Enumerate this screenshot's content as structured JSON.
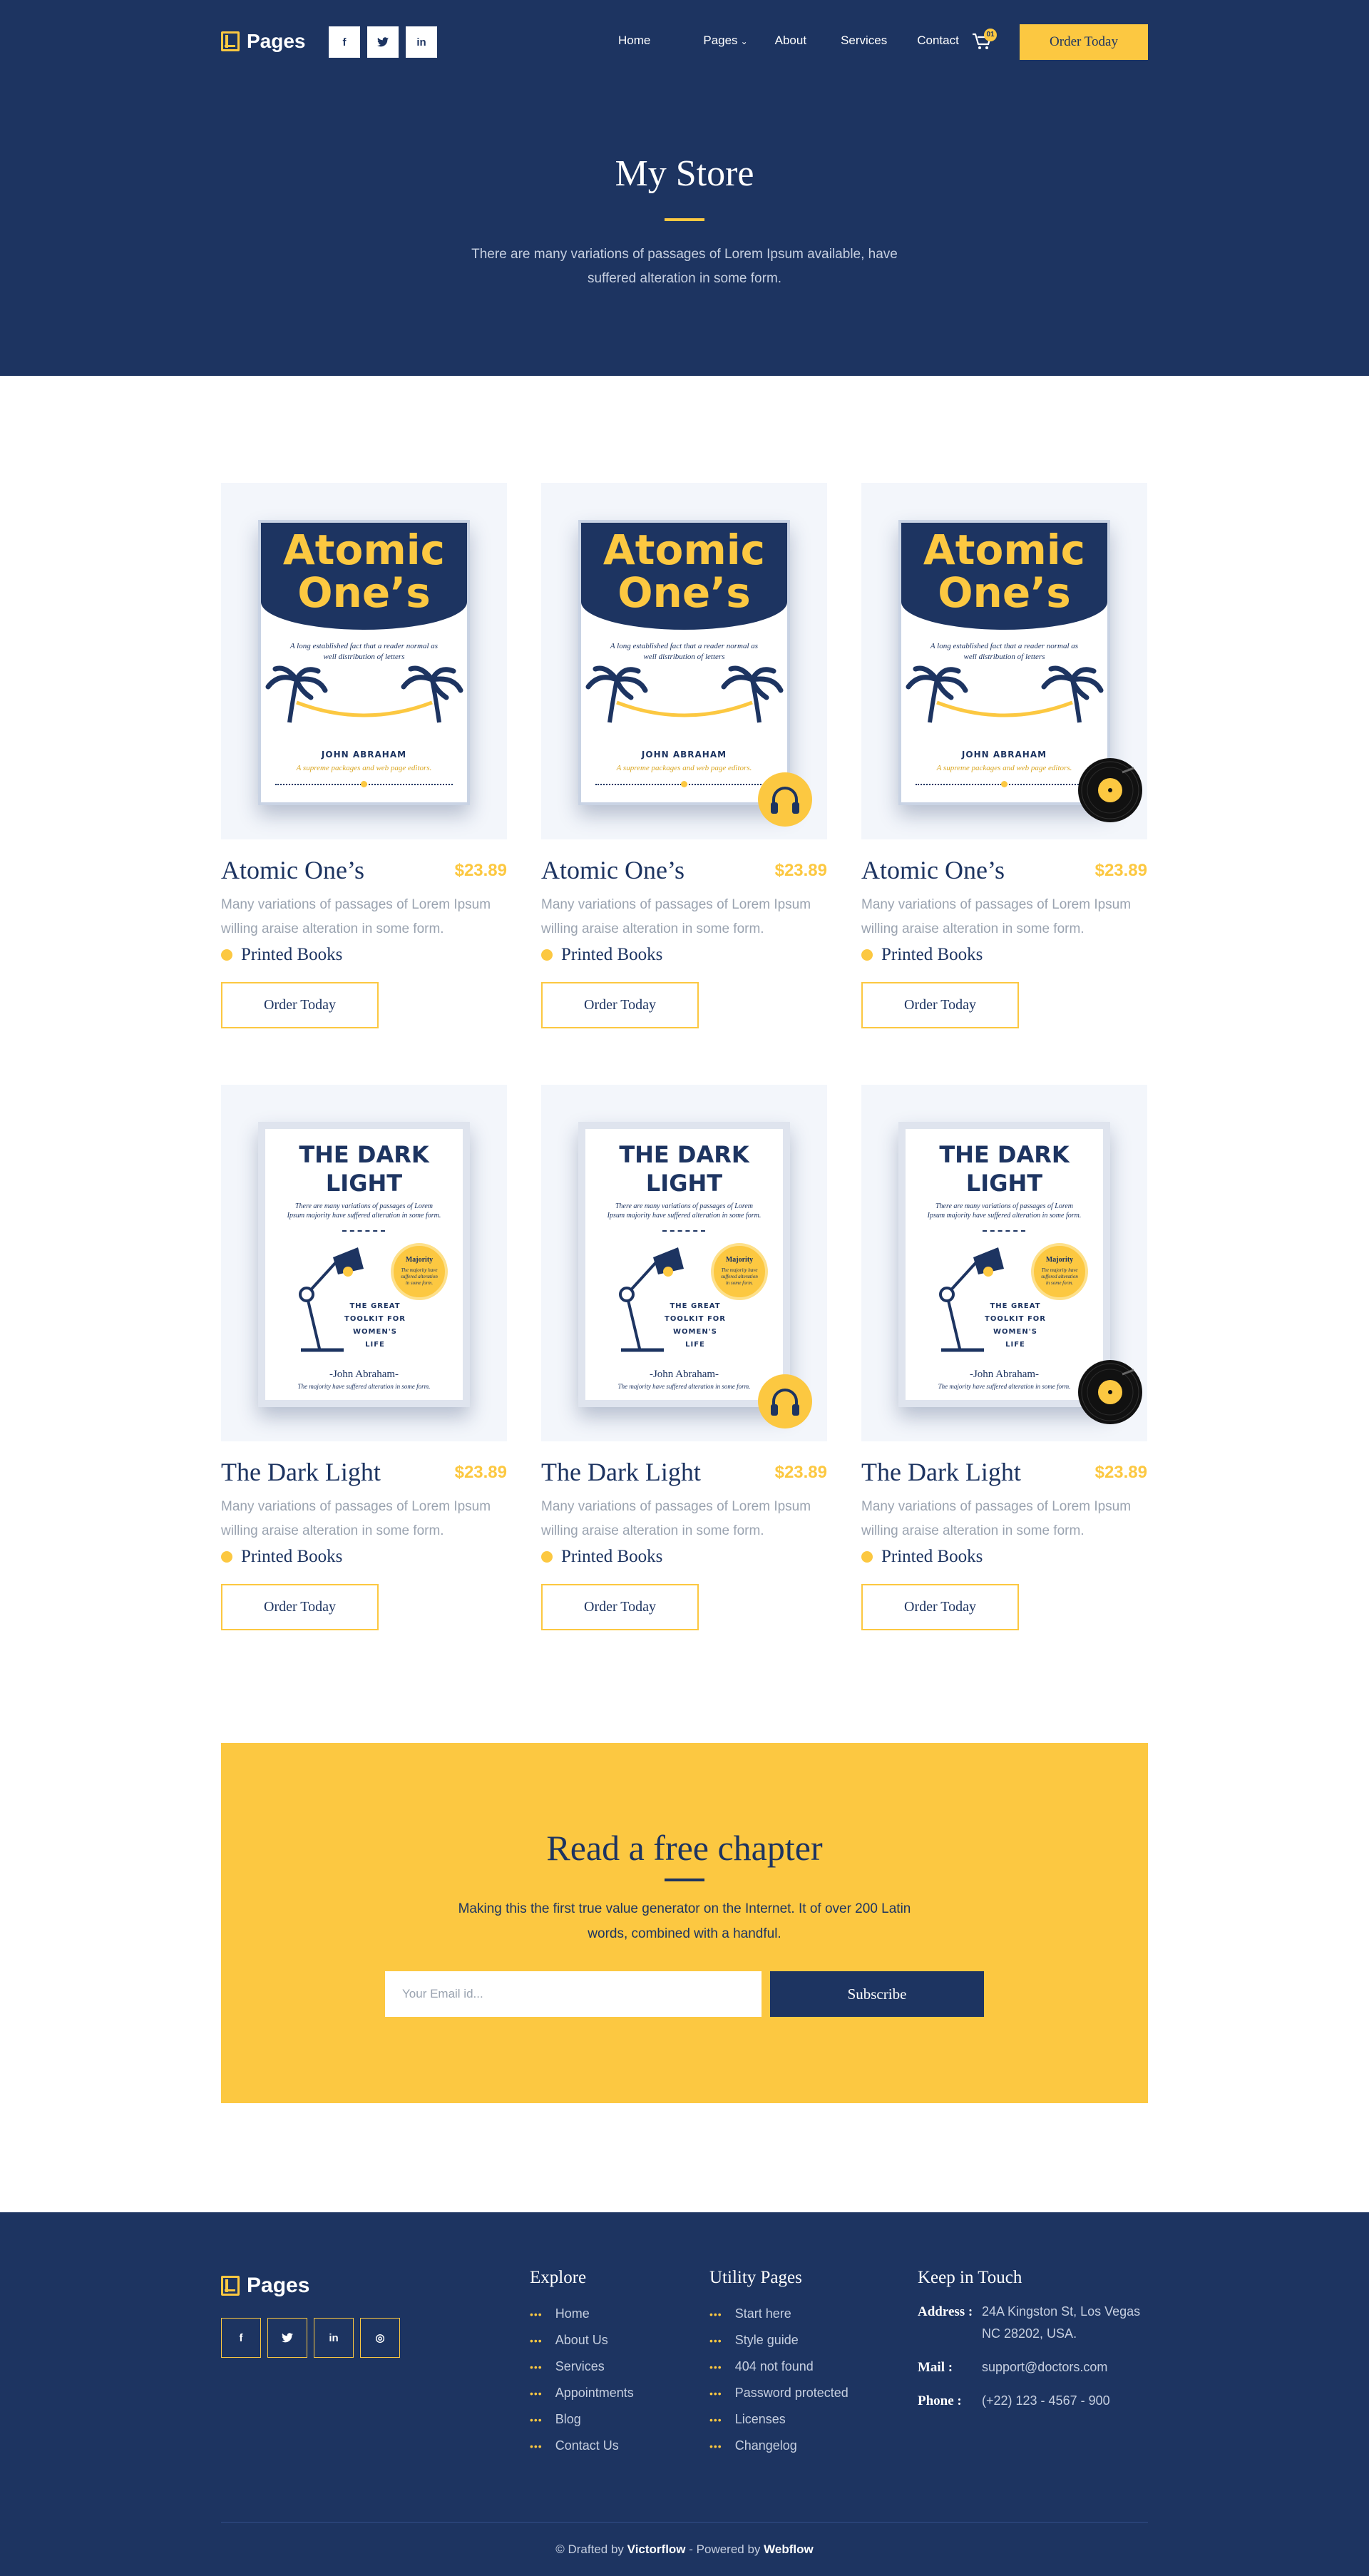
{
  "header": {
    "logo_text": "Pages",
    "social": [
      {
        "icon": "facebook-icon",
        "glyph": "f"
      },
      {
        "icon": "twitter-icon",
        "glyph": "t"
      },
      {
        "icon": "linkedin-icon",
        "glyph": "in"
      }
    ],
    "menu": [
      {
        "label": "Home"
      },
      {
        "label": "Pages"
      },
      {
        "label": "About"
      },
      {
        "label": "Services"
      },
      {
        "label": "Contact"
      }
    ],
    "cart_count": "01",
    "order_button": "Order Today"
  },
  "hero": {
    "title": "My Store",
    "subtitle": "There are many variations of passages of Lorem Ipsum available,  have suffered alteration in some form."
  },
  "products": [
    {
      "title": "Atomic One’s",
      "price": "$23.89",
      "description": "Many variations of passages of Lorem Ipsum willing araise  alteration in some form.",
      "category": "Printed Books",
      "button": "Order Today",
      "badge": "none",
      "cover": "atomic"
    },
    {
      "title": "Atomic One’s",
      "price": "$23.89",
      "description": "Many variations of passages of Lorem Ipsum willing araise  alteration in some form.",
      "category": "Printed Books",
      "button": "Order Today",
      "badge": "audio",
      "cover": "atomic"
    },
    {
      "title": "Atomic One’s",
      "price": "$23.89",
      "description": "Many variations of passages of Lorem Ipsum willing araise  alteration in some form.",
      "category": "Printed Books",
      "button": "Order Today",
      "badge": "vinyl",
      "cover": "atomic"
    },
    {
      "title": "The Dark Light",
      "price": "$23.89",
      "description": "Many variations of passages of Lorem Ipsum willing araise  alteration in some form.",
      "category": "Printed Books",
      "button": "Order Today",
      "badge": "none",
      "cover": "dark"
    },
    {
      "title": "The Dark Light",
      "price": "$23.89",
      "description": "Many variations of passages of Lorem Ipsum willing araise  alteration in some form.",
      "category": "Printed Books",
      "button": "Order Today",
      "badge": "audio",
      "cover": "dark"
    },
    {
      "title": "The Dark Light",
      "price": "$23.89",
      "description": "Many variations of passages of Lorem Ipsum willing araise  alteration in some form.",
      "category": "Printed Books",
      "button": "Order Today",
      "badge": "vinyl",
      "cover": "dark"
    }
  ],
  "covers": {
    "atomic": {
      "line1": "Atomic",
      "line2": "One’s",
      "blurb": "A long established fact that a reader normal as well distribution of letters",
      "author": "JOHN ABRAHAM",
      "tagline": "A supreme packages and web page editors."
    },
    "dark": {
      "line1": "THE DARK",
      "line2": "LIGHT",
      "blurb": "There are many variations of passages of Lorem Ipsum majority have suffered alteration in some form.",
      "seal_title": "Majority",
      "seal_text": "The majority have suffered alteration in some form.",
      "toolkit": "THE GREAT TOOLKIT FOR WOMEN'S LIFE",
      "author": "-John Abraham-",
      "footer_text": "The majority have suffered alteration in some form."
    }
  },
  "cta": {
    "title": "Read a free chapter",
    "subtitle": "Making this the first true value generator on the Internet. It of over 200 Latin words, combined with a handful.",
    "email_placeholder": "Your Email id...",
    "button": "Subscribe"
  },
  "footer": {
    "logo_text": "Pages",
    "social": [
      {
        "icon": "facebook-icon",
        "glyph": "f"
      },
      {
        "icon": "twitter-icon",
        "glyph": "t"
      },
      {
        "icon": "linkedin-icon",
        "glyph": "in"
      },
      {
        "icon": "instagram-icon",
        "glyph": "◎"
      }
    ],
    "explore": {
      "title": "Explore",
      "links": [
        "Home",
        "About Us",
        "Services",
        "Appointments",
        "Blog",
        "Contact Us"
      ]
    },
    "utility": {
      "title": "Utility Pages",
      "links": [
        "Start here",
        "Style guide",
        "404 not found",
        "Password protected",
        "Licenses",
        "Changelog"
      ]
    },
    "contact": {
      "title": "Keep in Touch",
      "address_label": "Address :",
      "address": "24A Kingston St, Los Vegas NC 28202, USA.",
      "mail_label": "Mail :",
      "mail": "support@doctors.com",
      "phone_label": "Phone :",
      "phone": "(+22) 123 - 4567 - 900"
    },
    "copyright_prefix": "© Drafted by",
    "drafted_by": "Victorflow",
    "powered_text": "- Powered by",
    "powered_by": "Webflow"
  },
  "colors": {
    "navy": "#1d3461",
    "yellow": "#fcc841",
    "light": "#f3f6fb"
  }
}
